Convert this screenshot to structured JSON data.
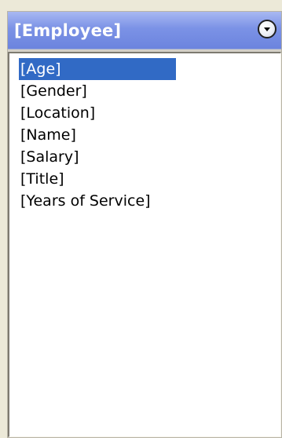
{
  "header": {
    "title": "[Employee]",
    "dropdown_icon": "chevron-down-circle-icon"
  },
  "list": {
    "items": [
      {
        "label": "[Age]",
        "selected": true
      },
      {
        "label": "[Gender]",
        "selected": false
      },
      {
        "label": "[Location]",
        "selected": false
      },
      {
        "label": "[Name]",
        "selected": false
      },
      {
        "label": "[Salary]",
        "selected": false
      },
      {
        "label": "[Title]",
        "selected": false
      },
      {
        "label": "[Years of Service]",
        "selected": false
      }
    ]
  },
  "colors": {
    "header_gradient_top": "#a8b8f2",
    "header_gradient_bottom": "#6c84de",
    "selection": "#316ac5",
    "list_background": "#ffffff"
  }
}
